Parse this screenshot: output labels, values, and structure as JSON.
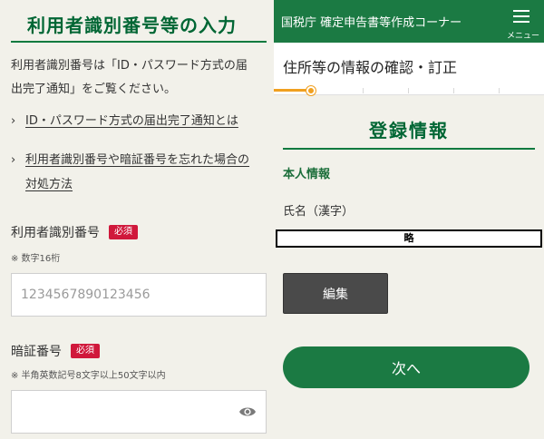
{
  "left": {
    "title": "利用者識別番号等の入力",
    "intro_line1": "利用者識別番号は「ID・パスワード方式の届",
    "intro_line2": "出完了通知」をご覧ください。",
    "links": [
      {
        "chevron": "›",
        "line1": "ID・パスワード方式の届出完了通知とは",
        "line2": ""
      },
      {
        "chevron": "›",
        "line1": "利用者識別番号や暗証番号を忘れた場合の",
        "line2": "対処方法"
      }
    ],
    "user_id": {
      "label": "利用者識別番号",
      "required": "必須",
      "note": "※ 数字16桁",
      "placeholder": "1234567890123456"
    },
    "password": {
      "label": "暗証番号",
      "required": "必須",
      "note": "※ 半角英数記号8文字以上50文字以内",
      "value": "",
      "toggle_icon": "eye-icon"
    }
  },
  "right": {
    "header_title": "国税庁 確定申告書等作成コーナー",
    "menu_label": "メニュー",
    "page_title": "住所等の情報の確認・訂正",
    "progress_fraction": 0.14,
    "section_title": "登録情報",
    "sub_title": "本人情報",
    "name_label": "氏名（漢字）",
    "name_value": "略",
    "edit_label": "編集",
    "next_label": "次へ"
  },
  "colors": {
    "brand_green": "#1b7a43",
    "title_green": "#006634",
    "required_red": "#d0183b",
    "progress_orange": "#f0a020",
    "background": "#f2f1ea"
  }
}
